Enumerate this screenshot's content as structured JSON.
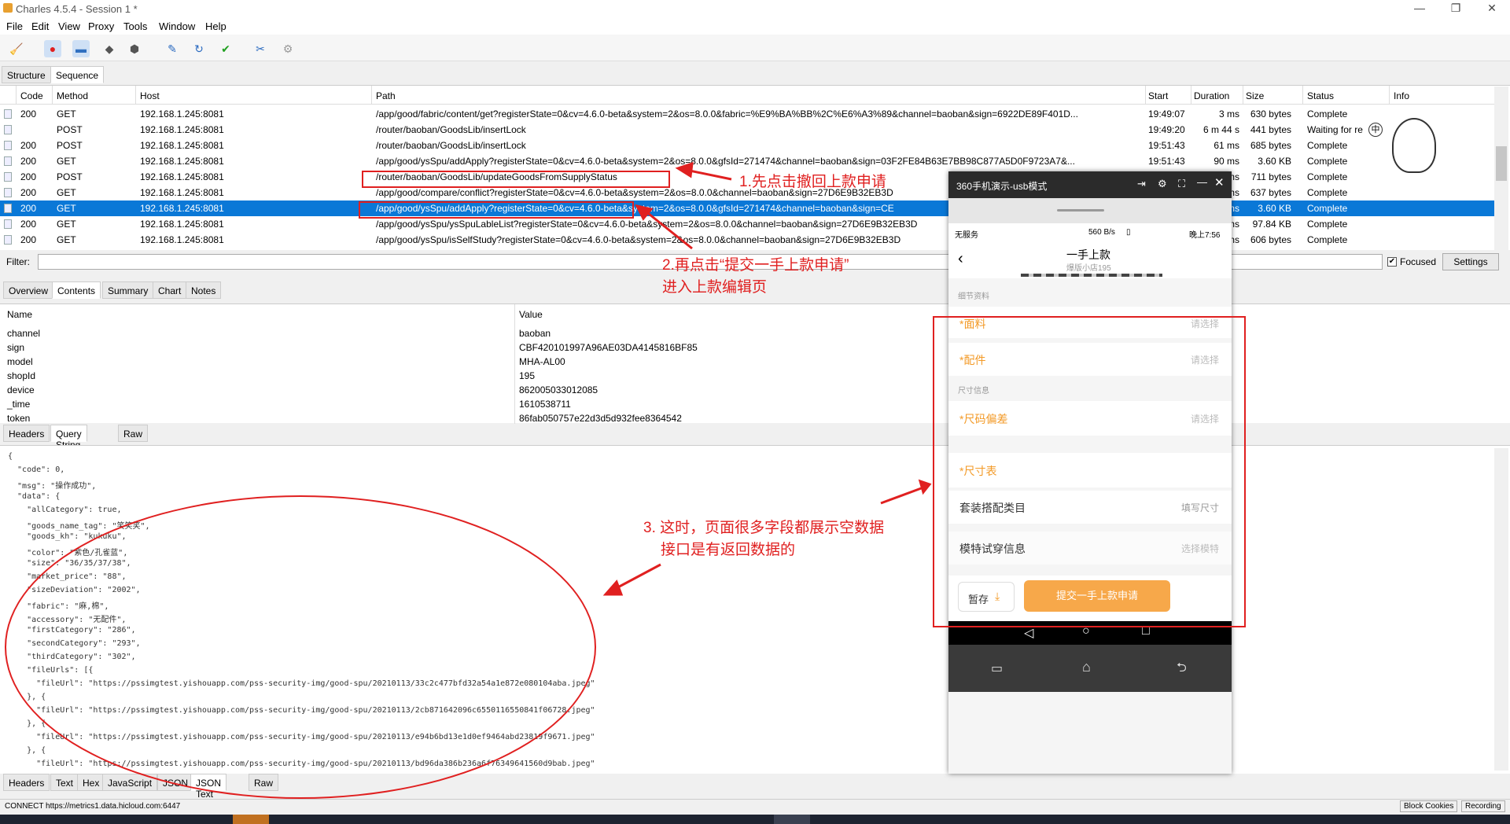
{
  "window": {
    "title": "Charles 4.5.4 - Session 1 *"
  },
  "menu": [
    "File",
    "Edit",
    "View",
    "Proxy",
    "Tools",
    "Window",
    "Help"
  ],
  "view_tabs": [
    "Structure",
    "Sequence"
  ],
  "columns": [
    "Code",
    "Method",
    "Host",
    "Path",
    "Start",
    "Duration",
    "Size",
    "Status",
    "Info"
  ],
  "rows": [
    {
      "code": "200",
      "method": "GET",
      "host": "192.168.1.245:8081",
      "path": "/app/good/fabric/content/get?registerState=0&cv=4.6.0-beta&system=2&os=8.0.0&fabric=%E9%BA%BB%2C%E6%A3%89&channel=baoban&sign=6922DE89F401D...",
      "start": "19:49:07",
      "duration": "3 ms",
      "size": "630 bytes",
      "status": "Complete"
    },
    {
      "code": "",
      "method": "POST",
      "host": "192.168.1.245:8081",
      "path": "/router/baoban/GoodsLib/insertLock",
      "start": "19:49:20",
      "duration": "6 m 44 s",
      "size": "441 bytes",
      "status": "Waiting for re"
    },
    {
      "code": "200",
      "method": "POST",
      "host": "192.168.1.245:8081",
      "path": "/router/baoban/GoodsLib/insertLock",
      "start": "19:51:43",
      "duration": "61 ms",
      "size": "685 bytes",
      "status": "Complete"
    },
    {
      "code": "200",
      "method": "GET",
      "host": "192.168.1.245:8081",
      "path": "/app/good/ysSpu/addApply?registerState=0&cv=4.6.0-beta&system=2&os=8.0.0&gfsId=271474&channel=baoban&sign=03F2FE84B63E7BB98C877A5D0F9723A7&...",
      "start": "19:51:43",
      "duration": "90 ms",
      "size": "3.60 KB",
      "status": "Complete"
    },
    {
      "code": "200",
      "method": "POST",
      "host": "192.168.1.245:8081",
      "path": "/router/baoban/GoodsLib/updateGoodsFromSupplyStatus",
      "start": "",
      "duration": "ms",
      "size": "711 bytes",
      "status": "Complete"
    },
    {
      "code": "200",
      "method": "GET",
      "host": "192.168.1.245:8081",
      "path": "/app/good/compare/conflict?registerState=0&cv=4.6.0-beta&system=2&os=8.0.0&channel=baoban&sign=27D6E9B32EB3D",
      "start": "",
      "duration": "ms",
      "size": "637 bytes",
      "status": "Complete"
    },
    {
      "code": "200",
      "method": "GET",
      "host": "192.168.1.245:8081",
      "path": "/app/good/ysSpu/addApply?registerState=0&cv=4.6.0-beta&system=2&os=8.0.0&gfsId=271474&channel=baoban&sign=CE",
      "start": "",
      "duration": "ms",
      "size": "3.60 KB",
      "status": "Complete"
    },
    {
      "code": "200",
      "method": "GET",
      "host": "192.168.1.245:8081",
      "path": "/app/good/ysSpu/ysSpuLableList?registerState=0&cv=4.6.0-beta&system=2&os=8.0.0&channel=baoban&sign=27D6E9B32EB3D",
      "start": "",
      "duration": "ms",
      "size": "97.84 KB",
      "status": "Complete"
    },
    {
      "code": "200",
      "method": "GET",
      "host": "192.168.1.245:8081",
      "path": "/app/good/ysSpu/isSelfStudy?registerState=0&cv=4.6.0-beta&system=2&os=8.0.0&channel=baoban&sign=27D6E9B32EB3D",
      "start": "",
      "duration": "ms",
      "size": "606 bytes",
      "status": "Complete"
    }
  ],
  "filter": {
    "label": "Filter:",
    "focused": "Focused",
    "settings": "Settings"
  },
  "detail_tabs": [
    "Overview",
    "Contents",
    "Summary",
    "Chart",
    "Notes"
  ],
  "param_headers": [
    "Name",
    "Value"
  ],
  "params": [
    {
      "k": "channel",
      "v": "baoban"
    },
    {
      "k": "sign",
      "v": "CBF420101997A96AE03DA4145816BF85"
    },
    {
      "k": "model",
      "v": "MHA-AL00"
    },
    {
      "k": "shopId",
      "v": "195"
    },
    {
      "k": "device",
      "v": "862005033012085"
    },
    {
      "k": "_time",
      "v": "1610538711"
    },
    {
      "k": "token",
      "v": "86fab050757e22d3d5d932fee8364542"
    }
  ],
  "req_tabs": [
    "Headers",
    "Query String",
    "Raw"
  ],
  "resp_tabs": [
    "Headers",
    "Text",
    "Hex",
    "JavaScript",
    "JSON",
    "JSON Text",
    "Raw"
  ],
  "json_lines": [
    "{",
    "  \"code\": 0,",
    "  \"msg\": \"操作成功\",",
    "  \"data\": {",
    "    \"allCategory\": true,",
    "    \"goods_name_tag\": \"笑笑笑\",",
    "    \"goods_kh\": \"kukuku\",",
    "    \"color\": \"紫色/孔雀蓝\",",
    "    \"size\": \"36/35/37/38\",",
    "    \"market_price\": \"88\",",
    "    \"sizeDeviation\": \"2002\",",
    "    \"fabric\": \"麻,棉\",",
    "    \"accessory\": \"无配件\",",
    "    \"firstCategory\": \"286\",",
    "    \"secondCategory\": \"293\",",
    "    \"thirdCategory\": \"302\",",
    "    \"fileUrls\": [{",
    "      \"fileUrl\": \"https://pssimgtest.yishouapp.com/pss-security-img/good-spu/20210113/33c2c477bfd32a54a1e872e080104aba.jpeg\"",
    "    }, {",
    "      \"fileUrl\": \"https://pssimgtest.yishouapp.com/pss-security-img/good-spu/20210113/2cb871642096c6550116550841f06728.jpeg\"",
    "    }, {",
    "      \"fileUrl\": \"https://pssimgtest.yishouapp.com/pss-security-img/good-spu/20210113/e94b6bd13e1d0ef9464abd23819f9671.jpeg\"",
    "    }, {",
    "      \"fileUrl\": \"https://pssimgtest.yishouapp.com/pss-security-img/good-spu/20210113/bd96da386b236a6f76349641560d9bab.jpeg\""
  ],
  "status": {
    "left": "CONNECT https://metrics1.data.hicloud.com:6447",
    "block": "Block Cookies",
    "recording": "Recording"
  },
  "phone": {
    "title": "360手机演示-usb模式",
    "statusbar_left": "无服务",
    "statusbar_right": "560 B/s",
    "time": "晚上7:56",
    "page_title": "一手上款",
    "page_sub": "爆版小店195",
    "section1": "细节资料",
    "fabric": "*面料",
    "accessory": "*配件",
    "choose": "请选择",
    "section2": "尺寸信息",
    "size_dev": "*尺码偏差",
    "size_table": "*尺寸表",
    "suit": "套装搭配类目",
    "fill_size": "填写尺寸",
    "model_info": "模特试穿信息",
    "choose_model": "选择模特",
    "save": "暂存",
    "submit": "提交一手上款申请"
  },
  "annotations": {
    "a1": "1.先点击撤回上款申请",
    "a2": "2.再点击“提交一手上款申请”",
    "a2b": "进入上款编辑页",
    "a3": "3. 这时，页面很多字段都展示空数据",
    "a3b": "接口是有返回数据的"
  },
  "side_widget": "中"
}
